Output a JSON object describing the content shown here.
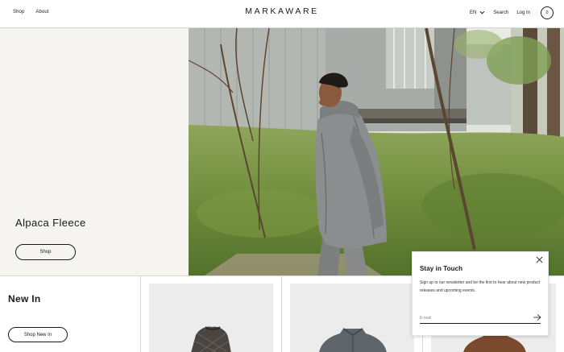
{
  "header": {
    "nav_left": [
      {
        "label": "Shop"
      },
      {
        "label": "About"
      }
    ],
    "logo": "MARKAWARE",
    "language": "EN",
    "search_label": "Search",
    "login_label": "Log In",
    "cart_count": "0"
  },
  "hero": {
    "title": "Alpaca Fleece",
    "button_label": "Shop"
  },
  "new_in": {
    "title": "New In",
    "button_label": "Shop New In"
  },
  "newsletter": {
    "title": "Stay in Touch",
    "text": "Sign up to our newsletter and be the first to hear about new product releases and upcoming events.",
    "email_placeholder": "E-mail"
  },
  "icons": [
    "chevron-down-icon",
    "cart-icon",
    "close-icon",
    "arrow-right-icon"
  ],
  "colors": {
    "text": "#1a1a1a",
    "hero_panel_bg": "#f6f4f0",
    "product_bg": "#ececec",
    "divider": "#d6d6d6"
  }
}
